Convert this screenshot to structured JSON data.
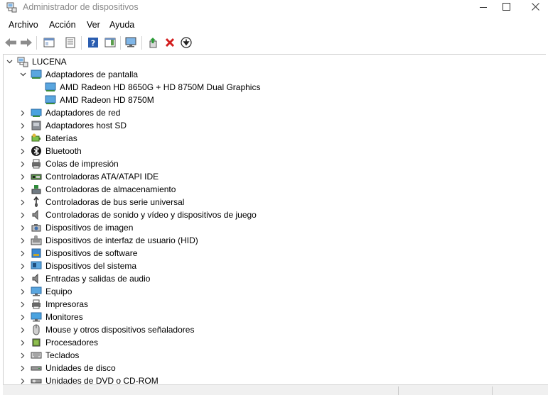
{
  "window": {
    "title": "Administrador de dispositivos"
  },
  "menu": [
    "Archivo",
    "Acción",
    "Ver",
    "Ayuda"
  ],
  "toolbar": [
    "back-arrow-icon",
    "forward-arrow-icon",
    "properties-pane-icon",
    "device-properties-icon",
    "help-icon",
    "action-pane-icon",
    "monitor-scan-icon",
    "update-driver-icon",
    "uninstall-icon",
    "download-icon"
  ],
  "tree": {
    "root": "LUCENA",
    "display_adapters": {
      "label": "Adaptadores de pantalla",
      "children": [
        "AMD Radeon HD 8650G + HD 8750M Dual Graphics",
        "AMD Radeon HD 8750M"
      ]
    },
    "categories": [
      {
        "label": "Adaptadores de red",
        "icon": "network-adapter-icon"
      },
      {
        "label": "Adaptadores host SD",
        "icon": "sd-host-icon"
      },
      {
        "label": "Baterías",
        "icon": "battery-icon"
      },
      {
        "label": "Bluetooth",
        "icon": "bluetooth-icon"
      },
      {
        "label": "Colas de impresión",
        "icon": "print-queue-icon"
      },
      {
        "label": "Controladoras ATA/ATAPI IDE",
        "icon": "ide-controller-icon"
      },
      {
        "label": "Controladoras de almacenamiento",
        "icon": "storage-controller-icon"
      },
      {
        "label": "Controladoras de bus serie universal",
        "icon": "usb-icon"
      },
      {
        "label": "Controladoras de sonido y vídeo y dispositivos de juego",
        "icon": "sound-icon"
      },
      {
        "label": "Dispositivos de imagen",
        "icon": "camera-icon"
      },
      {
        "label": "Dispositivos de interfaz de usuario (HID)",
        "icon": "hid-icon"
      },
      {
        "label": "Dispositivos de software",
        "icon": "software-device-icon"
      },
      {
        "label": "Dispositivos del sistema",
        "icon": "system-device-icon"
      },
      {
        "label": "Entradas y salidas de audio",
        "icon": "audio-io-icon"
      },
      {
        "label": "Equipo",
        "icon": "computer-icon"
      },
      {
        "label": "Impresoras",
        "icon": "printer-icon"
      },
      {
        "label": "Monitores",
        "icon": "monitor-icon"
      },
      {
        "label": "Mouse y otros dispositivos señaladores",
        "icon": "mouse-icon"
      },
      {
        "label": "Procesadores",
        "icon": "processor-icon"
      },
      {
        "label": "Teclados",
        "icon": "keyboard-icon"
      },
      {
        "label": "Unidades de disco",
        "icon": "disk-drive-icon"
      },
      {
        "label": "Unidades de DVD o CD-ROM",
        "icon": "dvd-drive-icon"
      }
    ]
  }
}
